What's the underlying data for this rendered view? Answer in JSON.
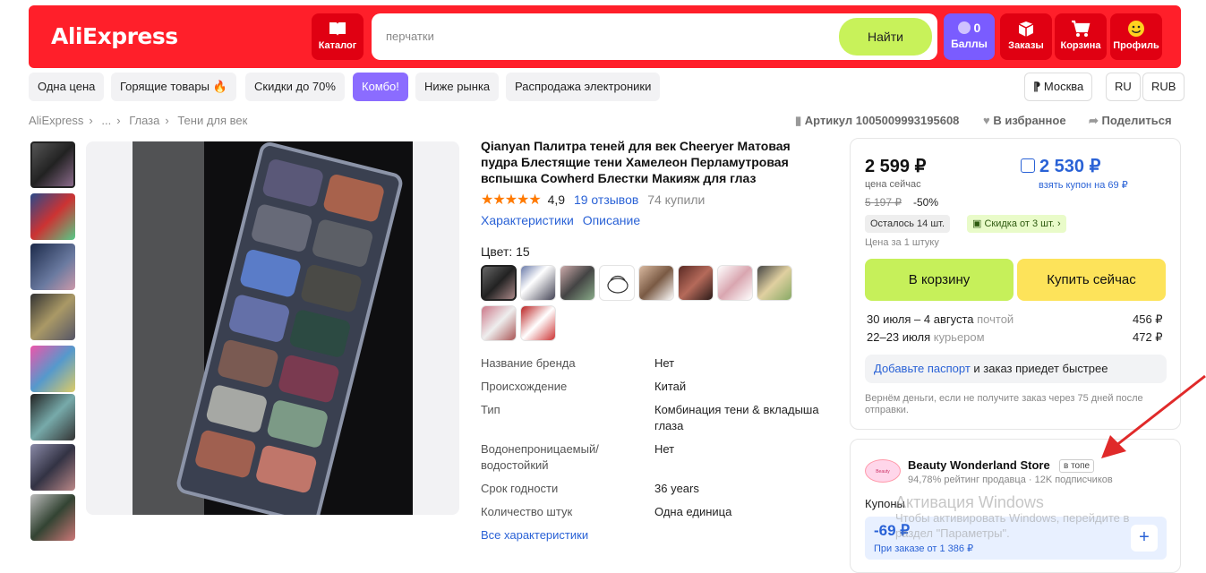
{
  "header": {
    "logo": "AliExpress",
    "catalog_label": "Каталог",
    "search_placeholder": "перчатки",
    "search_button": "Найти",
    "points_count": "0",
    "points_label": "Баллы",
    "orders_label": "Заказы",
    "cart_label": "Корзина",
    "profile_label": "Профиль"
  },
  "chips": [
    "Одна цена",
    "Горящие товары 🔥",
    "Скидки до 70%",
    "Комбо!",
    "Ниже рынка",
    "Распродажа электроники"
  ],
  "region": {
    "city": "Москва",
    "lang": "RU",
    "currency": "RUB"
  },
  "breadcrumb": [
    "AliExpress",
    "...",
    "Глаза",
    "Тени для век"
  ],
  "article": "Артикул 1005009993195608",
  "favorite": "В избранное",
  "share": "Поделиться",
  "product": {
    "title": "Qianyan Палитра теней для век Cheeryer Матовая пудра Блестящие тени Хамелеон Перламутровая вспышка Cowherd Блестки Макияж для глаз",
    "stars": "★★★★★",
    "rating": "4,9",
    "reviews": "19 отзывов",
    "bought": "74 купили",
    "tab_specs": "Характеристики",
    "tab_desc": "Описание",
    "color_label": "Цвет: 15",
    "specs": [
      {
        "k": "Название бренда",
        "v": "Нет"
      },
      {
        "k": "Происхождение",
        "v": "Китай"
      },
      {
        "k": "Тип",
        "v": "Комбинация тени & вкладыша глаза"
      },
      {
        "k": "Водонепроницаемый/ водостойкий",
        "v": "Нет"
      },
      {
        "k": "Срок годности",
        "v": "36 years"
      },
      {
        "k": "Количество штук",
        "v": "Одна единица"
      }
    ],
    "all_specs": "Все характеристики"
  },
  "buy": {
    "price_now": "2 599 ₽",
    "price_now_label": "цена сейчас",
    "price_coupon": "2 530 ₽",
    "coupon_label": "взять купон на 69 ₽",
    "old_price": "5 197 ₽",
    "discount": "-50%",
    "stock": "Осталось 14 шт.",
    "multi_discount": "Скидка от 3 шт.",
    "unit_note": "Цена за 1 штуку",
    "cart_btn": "В корзину",
    "buy_btn": "Купить сейчас",
    "delivery": [
      {
        "dates": "30 июля – 4 августа",
        "method": "почтой",
        "price": "456 ₽"
      },
      {
        "dates": "22–23 июля",
        "method": "курьером",
        "price": "472 ₽"
      }
    ],
    "passport_link": "Добавьте паспорт",
    "passport_text": " и заказ приедет быстрее",
    "refund_note": "Вернём деньги, если не получите заказ через 75 дней после отправки."
  },
  "store": {
    "logo_text": "Beauty Wonderland",
    "name": "Beauty Wonderland Store",
    "badge": "в топе",
    "stats": "94,78% рейтинг продавца · 12K подписчиков",
    "coupons_label": "Купоны",
    "coupon_value": "-69 ₽",
    "coupon_cond": "При заказе от 1 386 ₽",
    "coupon_add": "+"
  },
  "watermark": {
    "title": "Активация Windows",
    "text1": "Чтобы активировать Windows, перейдите в",
    "text2": "раздел \"Параметры\"."
  }
}
